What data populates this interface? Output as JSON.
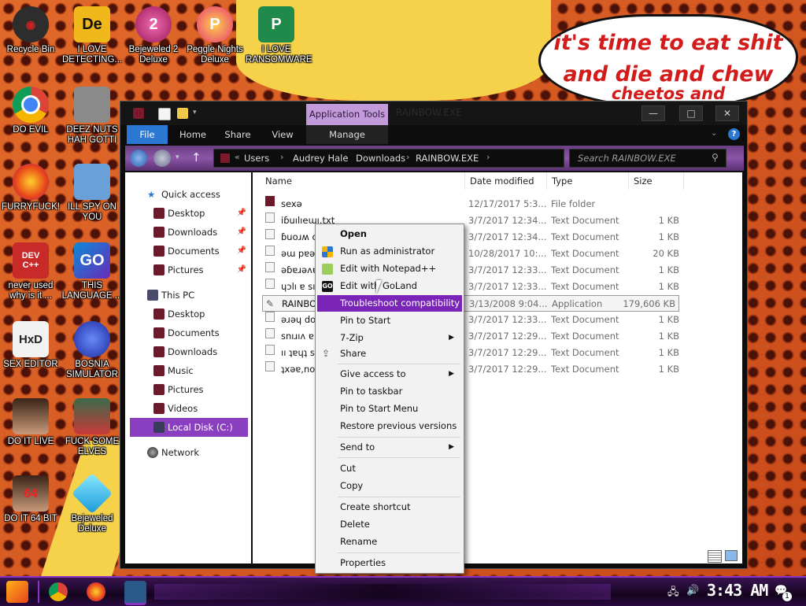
{
  "desktop": {
    "bubble": {
      "line1": "it's time to eat shit",
      "line2": "and die and chew",
      "line3": "cheetos and"
    },
    "icons": [
      {
        "label": "Recycle Bin",
        "icon": "recycle-bin-icon",
        "color": "#3a3a3a",
        "glyph": ""
      },
      {
        "label": "I LOVE DETECTING...",
        "icon": "detect-it-easy-icon",
        "color": "#f0b81a",
        "glyph": "De"
      },
      {
        "label": "Bejeweled 2 Deluxe",
        "icon": "bejeweled-2-icon",
        "color": "#d43a8a",
        "glyph": "2"
      },
      {
        "label": "Peggle Nights Deluxe",
        "icon": "peggle-icon",
        "color": "#e83a8a",
        "glyph": "P"
      },
      {
        "label": "I LOVE RANSOMWARE",
        "icon": "publisher-icon",
        "color": "#1f8a4a",
        "glyph": "P"
      },
      {
        "label": "DO EVIL",
        "icon": "chrome-icon",
        "color": "#2b80e0",
        "glyph": ""
      },
      {
        "label": "DEEZ NUTS HAH GOTTI",
        "icon": "windows-stack-icon",
        "color": "#8a8a8a",
        "glyph": ""
      },
      {
        "label": "FURRYFUCK!",
        "icon": "firefox-icon",
        "color": "#f07a1a",
        "glyph": ""
      },
      {
        "label": "ILL SPY ON YOU",
        "icon": "network-computer-icon",
        "color": "#6aa0d8",
        "glyph": ""
      },
      {
        "label": "never used why is it ...",
        "icon": "dev-cpp-icon",
        "color": "#c82a2a",
        "glyph": "DEV C++"
      },
      {
        "label": "THIS LANGUAGE ...",
        "icon": "goland-icon",
        "color": "#3a2a8a",
        "glyph": "GO"
      },
      {
        "label": "SEX EDITOR",
        "icon": "hxd-icon",
        "color": "#f2f2f2",
        "glyph": "HxD"
      },
      {
        "label": "BOSNIA SIMULATOR",
        "icon": "minesweeper-icon",
        "color": "#1a3aa0",
        "glyph": ""
      },
      {
        "label": "DO IT LIVE",
        "icon": "portrait-icon",
        "color": "#6a4030",
        "glyph": ""
      },
      {
        "label": "FUCK SOME ELVES",
        "icon": "elf-game-icon",
        "color": "#3a6a4a",
        "glyph": ""
      },
      {
        "label": "DO IT 64 BIT",
        "icon": "portrait-64-icon",
        "color": "#6a4030",
        "glyph": "64"
      },
      {
        "label": "Bejeweled Deluxe",
        "icon": "gem-icon",
        "color": "#2ab8e8",
        "glyph": ""
      }
    ]
  },
  "window": {
    "title": "RAINBOW.EXE",
    "app_tools": "Application Tools",
    "tabs": {
      "file": "File",
      "home": "Home",
      "share": "Share",
      "view": "View",
      "manage": "Manage"
    },
    "breadcrumb": [
      "Users",
      "Audrey Hale",
      "Downloads",
      "RAINBOW.EXE"
    ],
    "search_placeholder": "Search RAINBOW.EXE",
    "caption_buttons": {
      "minimize": "—",
      "maximize": "□",
      "close": "✕"
    },
    "nav": {
      "quick_access": "Quick access",
      "qa_items": [
        "Desktop",
        "Downloads",
        "Documents",
        "Pictures"
      ],
      "this_pc": "This PC",
      "pc_items": [
        "Desktop",
        "Documents",
        "Downloads",
        "Music",
        "Pictures",
        "Videos",
        "Local Disk (C:)"
      ],
      "network": "Network"
    },
    "columns": {
      "name": "Name",
      "date": "Date modified",
      "type": "Type",
      "size": "Size"
    },
    "files": [
      {
        "name": "sexǝ",
        "date": "12/17/2017 5:3...",
        "type": "File folder",
        "size": ""
      },
      {
        "name": "iɓuılıeɯı.txt",
        "date": "3/7/2017 12:34...",
        "type": "Text Document",
        "size": "1 KB"
      },
      {
        "name": "ɓuoɹʍ ol",
        "date": "3/7/2017 12:34...",
        "type": "Text Document",
        "size": "1 KB"
      },
      {
        "name": "ǝɯ pɐǝɹ.t",
        "date": "10/28/2017 10:...",
        "type": "Text Document",
        "size": "20 KB"
      },
      {
        "name": "ǝɓɐɹǝʌɐ ǝ",
        "date": "3/7/2017 12:33...",
        "type": "Text Document",
        "size": "1 KB"
      },
      {
        "name": "ɥɔlı ɐ sı pu",
        "date": "3/7/2017 12:33...",
        "type": "Text Document",
        "size": "1 KB"
      },
      {
        "name": "RAINBOW",
        "date": "3/13/2008 9:04...",
        "type": "Application",
        "size": "179,606 KB"
      },
      {
        "name": "ǝɹǝɥ doʇs ı",
        "date": "3/7/2017 12:33...",
        "type": "Text Document",
        "size": "1 KB"
      },
      {
        "name": "snıɹıʌ ɐ sı",
        "date": "3/7/2017 12:29...",
        "type": "Text Document",
        "size": "1 KB"
      },
      {
        "name": "ıı ʇɐɥʇ sı ʇı",
        "date": "3/7/2017 12:29...",
        "type": "Text Document",
        "size": "1 KB"
      },
      {
        "name": "ʇxǝɐ,no",
        "date": "3/7/2017 12:29...",
        "type": "Text Document",
        "size": "1 KB"
      }
    ]
  },
  "context_menu": {
    "open": "Open",
    "run_admin": "Run as administrator",
    "notepad": "Edit with Notepad++",
    "goland": "Edit with GoLand",
    "troubleshoot": "Troubleshoot compatibility",
    "pin_start": "Pin to Start",
    "zip": "7-Zip",
    "share": "Share",
    "give_access": "Give access to",
    "pin_taskbar": "Pin to taskbar",
    "pin_start_menu": "Pin to Start Menu",
    "restore": "Restore previous versions",
    "send_to": "Send to",
    "cut": "Cut",
    "copy": "Copy",
    "create_shortcut": "Create shortcut",
    "delete": "Delete",
    "rename": "Rename",
    "properties": "Properties"
  },
  "taskbar": {
    "clock": "3:43 AM",
    "notification_count": "1",
    "accent": "#8b35c6"
  }
}
